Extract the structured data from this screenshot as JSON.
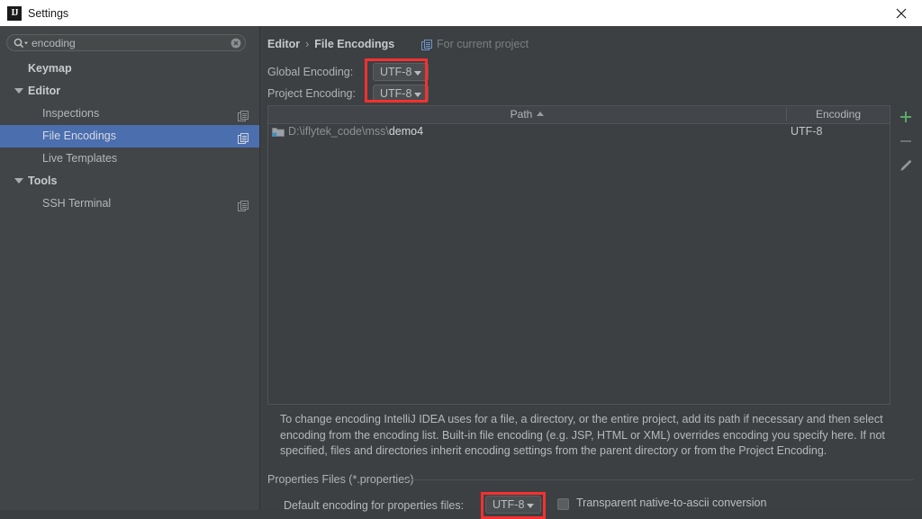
{
  "window": {
    "title": "Settings",
    "app_icon": "intellij-idea-icon",
    "close_icon": "close-icon"
  },
  "sidebar": {
    "search": {
      "value": "encoding",
      "placeholder": "Search settings",
      "icon": "search-icon",
      "dropdown_icon": "chevron-down-icon",
      "clear_icon": "clear-circle-icon"
    },
    "items": [
      {
        "label": "Keymap",
        "level": 0,
        "expandable": false,
        "selected": false,
        "project_icon": false
      },
      {
        "label": "Editor",
        "level": 0,
        "expandable": true,
        "selected": false,
        "project_icon": false
      },
      {
        "label": "Inspections",
        "level": 1,
        "expandable": false,
        "selected": false,
        "project_icon": true
      },
      {
        "label": "File Encodings",
        "level": 1,
        "expandable": false,
        "selected": true,
        "project_icon": true
      },
      {
        "label": "Live Templates",
        "level": 1,
        "expandable": false,
        "selected": false,
        "project_icon": false
      },
      {
        "label": "Tools",
        "level": 0,
        "expandable": true,
        "selected": false,
        "project_icon": false
      },
      {
        "label": "SSH Terminal",
        "level": 1,
        "expandable": false,
        "selected": false,
        "project_icon": true
      }
    ]
  },
  "content": {
    "breadcrumb": {
      "parent": "Editor",
      "separator": "›",
      "current": "File Encodings",
      "scope_icon": "project-scope-icon",
      "scope_note": "For current project"
    },
    "global_encoding": {
      "label": "Global Encoding:",
      "value": "UTF-8"
    },
    "project_encoding": {
      "label": "Project Encoding:",
      "value": "UTF-8"
    },
    "table": {
      "columns": [
        {
          "label": "Path",
          "sorted": "asc"
        },
        {
          "label": "Encoding",
          "sorted": "none"
        }
      ],
      "rows": [
        {
          "icon": "module-folder-icon",
          "path_prefix": "D:\\iflytek_code\\mss\\",
          "path_name": "demo4",
          "encoding": "UTF-8"
        }
      ]
    },
    "table_toolbar": [
      {
        "name": "add-button",
        "icon": "plus-icon",
        "enabled": true
      },
      {
        "name": "remove-button",
        "icon": "minus-icon",
        "enabled": false
      },
      {
        "name": "edit-button",
        "icon": "pencil-icon",
        "enabled": true
      }
    ],
    "description": "To change encoding IntelliJ IDEA uses for a file, a directory, or the entire project, add its path if necessary and then select encoding from the encoding list. Built-in file encoding (e.g. JSP, HTML or XML) overrides encoding you specify here. If not specified, files and directories inherit encoding settings from the parent directory or from the Project Encoding.",
    "properties_group": {
      "title": "Properties Files (*.properties)",
      "default_encoding_label": "Default encoding for properties files:",
      "default_encoding_value": "UTF-8",
      "transparent_checkbox_label": "Transparent native-to-ascii conversion",
      "transparent_checkbox_checked": false
    }
  },
  "annotations": {
    "highlight_color": "#f7302f",
    "boxes": [
      "encoding-combos-highlight",
      "properties-encoding-highlight"
    ]
  },
  "colors": {
    "selection": "#4b6eaf",
    "sidebar_bg": "#414547",
    "content_bg": "#3c4043",
    "titlebar_bg": "#ffffff",
    "accent_add": "#59a869"
  }
}
